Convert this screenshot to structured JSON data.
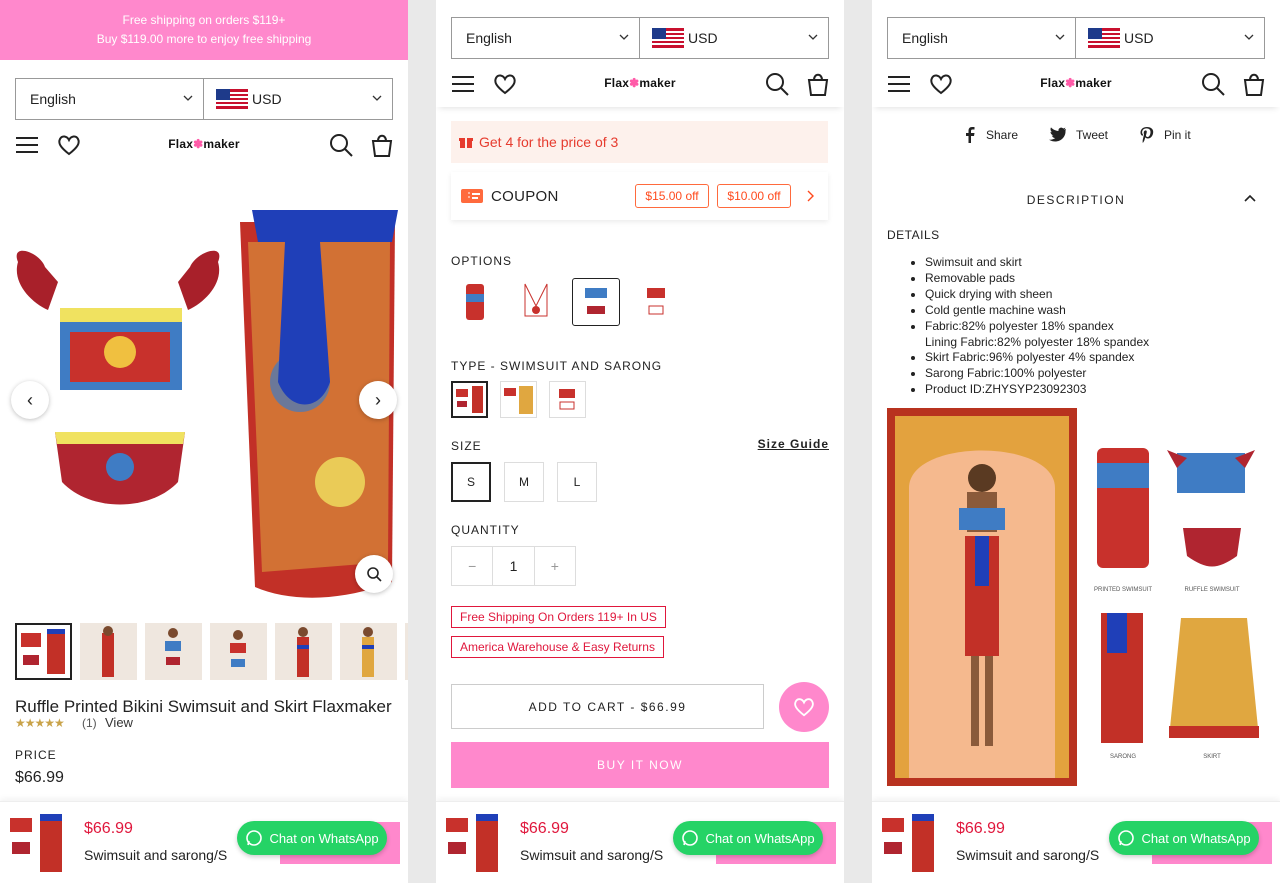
{
  "announcement": {
    "line1": "Free shipping on orders $119+",
    "line2": "Buy $119.00 more to enjoy free shipping"
  },
  "selectors": {
    "language": "English",
    "currency": "USD"
  },
  "header": {
    "logo_left": "Flax",
    "logo_right": "maker"
  },
  "product": {
    "title": "Ruffle Printed Bikini Swimsuit and Skirt Flaxmaker",
    "stars": "★★★★★",
    "rating_count": "(1)",
    "review_link": "View",
    "price_label": "PRICE",
    "price": "$66.99"
  },
  "promo": {
    "text": "Get 4 for the price of 3"
  },
  "coupon": {
    "label": "COUPON",
    "tags": [
      "$15.00 off",
      "$10.00 off"
    ]
  },
  "options": {
    "label": "OPTIONS",
    "type_label": "TYPE - SWIMSUIT AND SARONG",
    "size_label": "SIZE",
    "size_guide": "Size Guide",
    "sizes": [
      "S",
      "M",
      "L"
    ],
    "quantity_label": "QUANTITY",
    "quantity": "1",
    "minus": "−",
    "plus": "+"
  },
  "badges": [
    "Free Shipping On Orders 119+ In US",
    "America Warehouse & Easy Returns"
  ],
  "actions": {
    "add_to_cart": "ADD TO CART - $66.99",
    "buy_now": "BUY IT NOW"
  },
  "sticky": {
    "price": "$66.99",
    "variant": "Swimsuit and sarong/S",
    "whatsapp": "Chat on WhatsApp"
  },
  "share": {
    "share": "Share",
    "tweet": "Tweet",
    "pin": "Pin it"
  },
  "description": {
    "heading": "DESCRIPTION",
    "details_heading": "DETAILS",
    "items": [
      "Swimsuit and skirt",
      "Removable pads",
      "Quick drying with sheen",
      "Cold gentle machine wash",
      "Fabric:82% polyester 18% spandex",
      "Lining Fabric:82% polyester 18% spandex",
      "Skirt Fabric:96% polyester 4% spandex",
      "Sarong Fabric:100% polyester",
      "Product ID:ZHYSYP23092303"
    ],
    "captions": [
      "PRINTED SWIMSUIT",
      "RUFFLE SWIMSUIT",
      "SARONG",
      "SKIRT"
    ]
  },
  "colors": {
    "pink": "#ff88cc",
    "red": "#e0173c",
    "whatsapp": "#25d366",
    "promo_bg": "#fdf1ec"
  }
}
